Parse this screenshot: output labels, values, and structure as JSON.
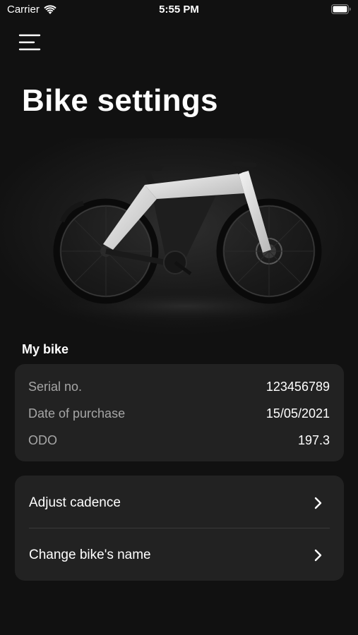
{
  "status_bar": {
    "carrier": "Carrier",
    "time": "5:55 PM"
  },
  "header": {
    "menu_icon": "hamburger-menu-icon",
    "title": "Bike settings"
  },
  "hero": {
    "image": "e-bike-photo"
  },
  "my_bike": {
    "section_title": "My bike",
    "rows": [
      {
        "label": "Serial no.",
        "value": "123456789"
      },
      {
        "label": "Date of purchase",
        "value": "15/05/2021"
      },
      {
        "label": "ODO",
        "value": "197.3"
      }
    ]
  },
  "actions": [
    {
      "label": "Adjust cadence",
      "icon": "chevron-right-icon"
    },
    {
      "label": "Change bike's name",
      "icon": "chevron-right-icon"
    }
  ],
  "colors": {
    "background": "#111111",
    "card": "#222222",
    "label": "#a6a6a6",
    "text": "#ffffff",
    "divider": "#3a3a3a"
  }
}
